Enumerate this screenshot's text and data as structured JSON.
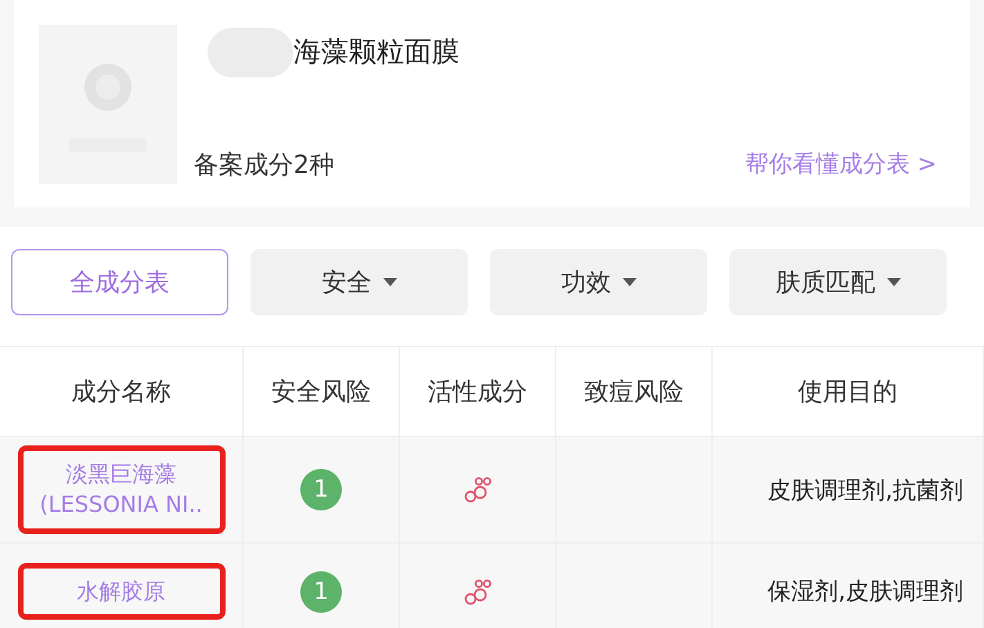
{
  "product": {
    "title": "海藻颗粒面膜",
    "ingredient_count": "备案成分2种",
    "help_link": "帮你看懂成分表 >"
  },
  "filters": [
    {
      "label": "全成分表",
      "kind": "plain",
      "selected": true
    },
    {
      "label": "安全",
      "kind": "dropdown",
      "selected": false
    },
    {
      "label": "功效",
      "kind": "dropdown",
      "selected": false
    },
    {
      "label": "肤质匹配",
      "kind": "dropdown",
      "selected": false
    }
  ],
  "table": {
    "columns": [
      "成分名称",
      "安全风险",
      "活性成分",
      "致痘风险",
      "使用目的"
    ],
    "rows": [
      {
        "name": "淡黑巨海藻\n(LESSONIA NI..",
        "safety": "1",
        "active": true,
        "purpose": "皮肤调理剂,抗菌剂",
        "highlighted": true
      },
      {
        "name": "水解胶原",
        "safety": "1",
        "active": true,
        "purpose": "保湿剂,皮肤调理剂",
        "highlighted": true
      }
    ]
  }
}
